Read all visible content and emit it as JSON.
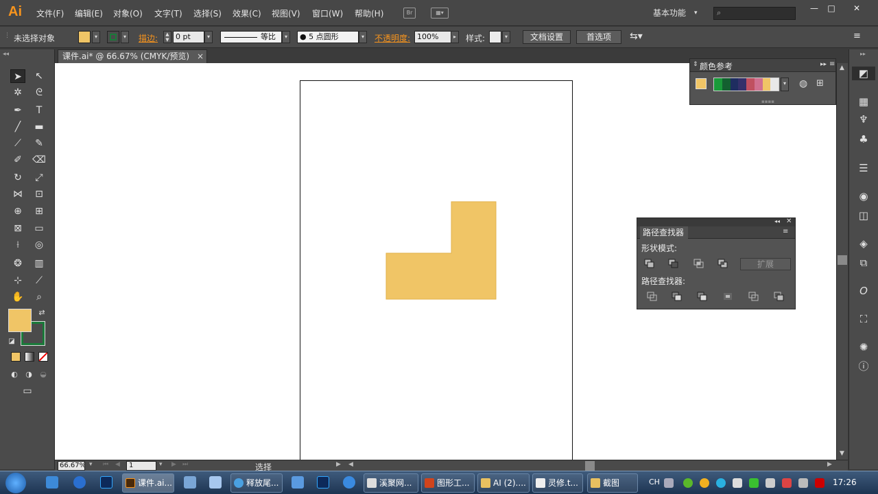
{
  "menubar": {
    "logo": "Ai",
    "menus": [
      "文件(F)",
      "编辑(E)",
      "对象(O)",
      "文字(T)",
      "选择(S)",
      "效果(C)",
      "视图(V)",
      "窗口(W)",
      "帮助(H)"
    ],
    "bridge_label": "Br",
    "workspace": "基本功能",
    "search_placeholder": "",
    "window_buttons": [
      "—",
      "□",
      "✕"
    ]
  },
  "control": {
    "no_selection": "未选择对象",
    "fill_color": "#f0c566",
    "stroke_color": "#1a7a3a",
    "stroke_label": "描边:",
    "stroke_weight": "0 pt",
    "profile": "等比",
    "brush": "● 5 点圆形",
    "opacity_label": "不透明度:",
    "opacity_value": "100%",
    "style_label": "样式:",
    "doc_setup": "文档设置",
    "prefs": "首选项"
  },
  "document": {
    "tab_title": "课件.ai* @ 66.67% (CMYK/预览)",
    "close": "×",
    "shape_color": "#f0c566"
  },
  "status": {
    "zoom": "66.67%",
    "page": "1",
    "tool": "选择"
  },
  "color_guide": {
    "title": "颜色参考",
    "base_color": "#f0c566",
    "harmony": [
      "#1a9a3a",
      "#136030",
      "#1e2d60",
      "#34306a",
      "#c05060",
      "#d07090",
      "#f0c566",
      "#e8e8e8"
    ]
  },
  "pathfinder": {
    "title": "路径查找器",
    "shape_modes": "形状模式:",
    "pathfinders": "路径查找器:",
    "expand": "扩展"
  },
  "taskbar": {
    "items": [
      "课件.ai...",
      "释放尾...",
      "溪聚网...",
      "图形工...",
      "AI (2)....",
      "灵修.t...",
      "截图"
    ],
    "ime": "CH",
    "clock": "17:26"
  }
}
